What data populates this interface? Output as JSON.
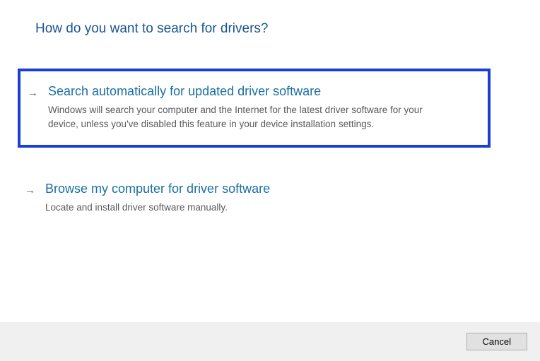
{
  "heading": "How do you want to search for drivers?",
  "options": [
    {
      "title": "Search automatically for updated driver software",
      "description": "Windows will search your computer and the Internet for the latest driver software for your device, unless you've disabled this feature in your device installation settings.",
      "selected": true
    },
    {
      "title": "Browse my computer for driver software",
      "description": "Locate and install driver software manually.",
      "selected": false
    }
  ],
  "footer": {
    "cancel_label": "Cancel"
  }
}
